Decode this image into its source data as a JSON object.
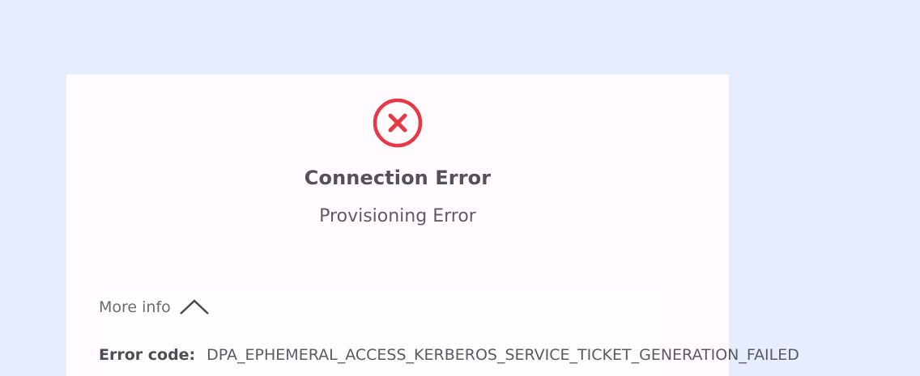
{
  "dialog": {
    "status_icon": "error-circle-x-icon",
    "title": "Connection Error",
    "subtitle": "Provisioning Error"
  },
  "more_info": {
    "label": "More info",
    "toggle_icon": "chevron-up-icon",
    "expanded": true
  },
  "details": {
    "error_code_label": "Error code:",
    "error_code_value": "DPA_EPHEMERAL_ACCESS_KERBEROS_SERVICE_TICKET_GENERATION_FAILED"
  },
  "colors": {
    "page_background": "#e6edfc",
    "card_background": "#fffbfe",
    "error_red": "#e63946",
    "text_primary": "#535258"
  }
}
